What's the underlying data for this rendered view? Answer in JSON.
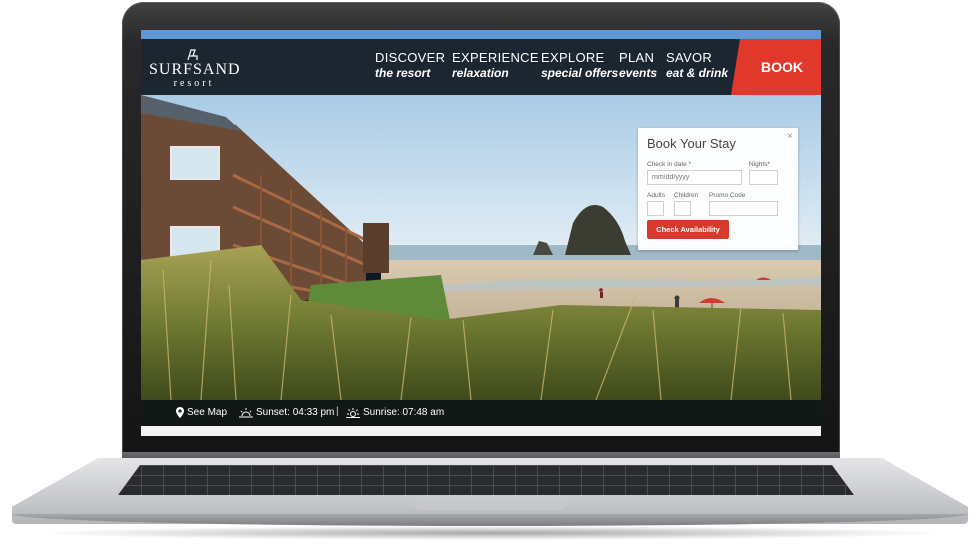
{
  "site": {
    "logo_name": "SURFSAND",
    "logo_sub": "resort",
    "logo_icon": "beach-chair-icon",
    "brand_color": "#e0392b",
    "nav_bg": "#1b2631",
    "accent_strip": "#5e98d6"
  },
  "nav": {
    "items": [
      {
        "top": "DISCOVER",
        "bottom": "the resort"
      },
      {
        "top": "EXPERIENCE",
        "bottom": "relaxation"
      },
      {
        "top": "EXPLORE",
        "bottom": "special offers"
      },
      {
        "top": "PLAN",
        "bottom": "events"
      },
      {
        "top": "SAVOR",
        "bottom": "eat & drink"
      }
    ],
    "book_label": "BOOK"
  },
  "booking": {
    "title": "Book Your Stay",
    "close_label": "×",
    "checkin_label": "Check in date *",
    "checkin_placeholder": "mm/dd/yyyy",
    "nights_label": "Nights*",
    "adults_label": "Adults",
    "children_label": "Children",
    "promo_label": "Promo Code",
    "submit_label": "Check Availability"
  },
  "info_bar": {
    "map_label": "See Map",
    "map_icon": "map-pin-icon",
    "sunset_label": "Sunset: 04:33 pm",
    "sunset_icon": "sunset-icon",
    "separator": "|",
    "sunrise_label": "Sunrise: 07:48 am",
    "sunrise_icon": "sunrise-icon"
  }
}
